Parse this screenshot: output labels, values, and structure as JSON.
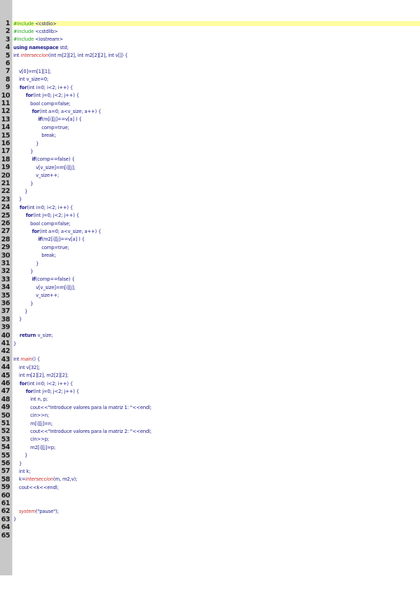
{
  "editor": {
    "current_line": 1,
    "lines": [
      [
        [
          "pp",
          "#include "
        ],
        [
          "p",
          "<cstdio>"
        ]
      ],
      [
        [
          "pp",
          "#include "
        ],
        [
          "p",
          "<cstdlib>"
        ]
      ],
      [
        [
          "pp",
          "#include "
        ],
        [
          "p",
          "<iostream>"
        ]
      ],
      [
        [
          "kw",
          "using namespace "
        ],
        [
          "p",
          "std;"
        ]
      ],
      [
        [
          "p",
          "int "
        ],
        [
          "fn",
          "interseccion"
        ],
        [
          "p",
          "(int m[2][2], int m2[2][2], int v[]) {"
        ]
      ],
      [],
      [
        [
          "p",
          "    v[0]=m[1][1];"
        ]
      ],
      [
        [
          "p",
          "    int v_size=0;"
        ]
      ],
      [
        [
          "kw",
          "    for"
        ],
        [
          "p",
          "(int i=0; i<2; i++) {"
        ]
      ],
      [
        [
          "kw",
          "        for"
        ],
        [
          "p",
          "(int j=0; j<2; j++) {"
        ]
      ],
      [
        [
          "p",
          "            bool comp=false;"
        ]
      ],
      [
        [
          "kw",
          "            for"
        ],
        [
          "p",
          "(int a=0; a<v_size; a++) {"
        ]
      ],
      [
        [
          "kw",
          "                if"
        ],
        [
          "p",
          "(m[i][j]==v[a] ) {"
        ]
      ],
      [
        [
          "p",
          "                    comp=true;"
        ]
      ],
      [
        [
          "p",
          "                    break;"
        ]
      ],
      [
        [
          "p",
          "                }"
        ]
      ],
      [
        [
          "p",
          "            }"
        ]
      ],
      [
        [
          "kw",
          "            if"
        ],
        [
          "p",
          "(comp==false) {"
        ]
      ],
      [
        [
          "p",
          "                v[v_size]=m[i][j];"
        ]
      ],
      [
        [
          "p",
          "                v_size++;"
        ]
      ],
      [
        [
          "p",
          "            }"
        ]
      ],
      [
        [
          "p",
          "        }"
        ]
      ],
      [
        [
          "p",
          "    }"
        ]
      ],
      [
        [
          "kw",
          "    for"
        ],
        [
          "p",
          "(int i=0; i<2; i++) {"
        ]
      ],
      [
        [
          "kw",
          "        for"
        ],
        [
          "p",
          "(int j=0; j<2; j++) {"
        ]
      ],
      [
        [
          "p",
          "            bool comp=false;"
        ]
      ],
      [
        [
          "kw",
          "            for"
        ],
        [
          "p",
          "(int a=0; a<v_size; a++) {"
        ]
      ],
      [
        [
          "kw",
          "                if"
        ],
        [
          "p",
          "(m2[i][j]==v[a] ) {"
        ]
      ],
      [
        [
          "p",
          "                    comp=true;"
        ]
      ],
      [
        [
          "p",
          "                    break;"
        ]
      ],
      [
        [
          "p",
          "                }"
        ]
      ],
      [
        [
          "p",
          "            }"
        ]
      ],
      [
        [
          "kw",
          "            if"
        ],
        [
          "p",
          "(comp==false) {"
        ]
      ],
      [
        [
          "p",
          "                v[v_size]=m[i][j];"
        ]
      ],
      [
        [
          "p",
          "                v_size++;"
        ]
      ],
      [
        [
          "p",
          "            }"
        ]
      ],
      [
        [
          "p",
          "        }"
        ]
      ],
      [
        [
          "p",
          "    }"
        ]
      ],
      [],
      [
        [
          "kw",
          "    return "
        ],
        [
          "p",
          "v_size;"
        ]
      ],
      [
        [
          "p",
          "}"
        ]
      ],
      [],
      [
        [
          "p",
          "int "
        ],
        [
          "fn",
          "main"
        ],
        [
          "p",
          "() {"
        ]
      ],
      [
        [
          "p",
          "    int v[32];"
        ]
      ],
      [
        [
          "p",
          "    int m[2][2], m2[2][2];"
        ]
      ],
      [
        [
          "kw",
          "    for"
        ],
        [
          "p",
          "(int i=0; i<2; i++) {"
        ]
      ],
      [
        [
          "kw",
          "        for"
        ],
        [
          "p",
          "(int j=0; j<2; j++) {"
        ]
      ],
      [
        [
          "p",
          "            int n, p;"
        ]
      ],
      [
        [
          "p",
          "            cout<<\"Introduce valores para la matriz 1: \"<<endl;"
        ]
      ],
      [
        [
          "p",
          "            cin>>n;"
        ]
      ],
      [
        [
          "p",
          "            m[i][j]=n;"
        ]
      ],
      [
        [
          "p",
          "            cout<<\"Introduce valores para la matriz 2: \"<<endl;"
        ]
      ],
      [
        [
          "p",
          "            cin>>p;"
        ]
      ],
      [
        [
          "p",
          "            m2[i][j]=p;"
        ]
      ],
      [
        [
          "p",
          "        }"
        ]
      ],
      [
        [
          "p",
          "    }"
        ]
      ],
      [
        [
          "p",
          "    int k;"
        ]
      ],
      [
        [
          "p",
          "    k="
        ],
        [
          "fn",
          "interseccion"
        ],
        [
          "p",
          "(m, m2,v);"
        ]
      ],
      [
        [
          "p",
          "    cout<<k<<endl;"
        ]
      ],
      [],
      [],
      [
        [
          "p",
          "    "
        ],
        [
          "fn",
          "system"
        ],
        [
          "p",
          "(\"pause\");"
        ]
      ],
      [
        [
          "p",
          "}"
        ]
      ],
      [],
      []
    ]
  }
}
